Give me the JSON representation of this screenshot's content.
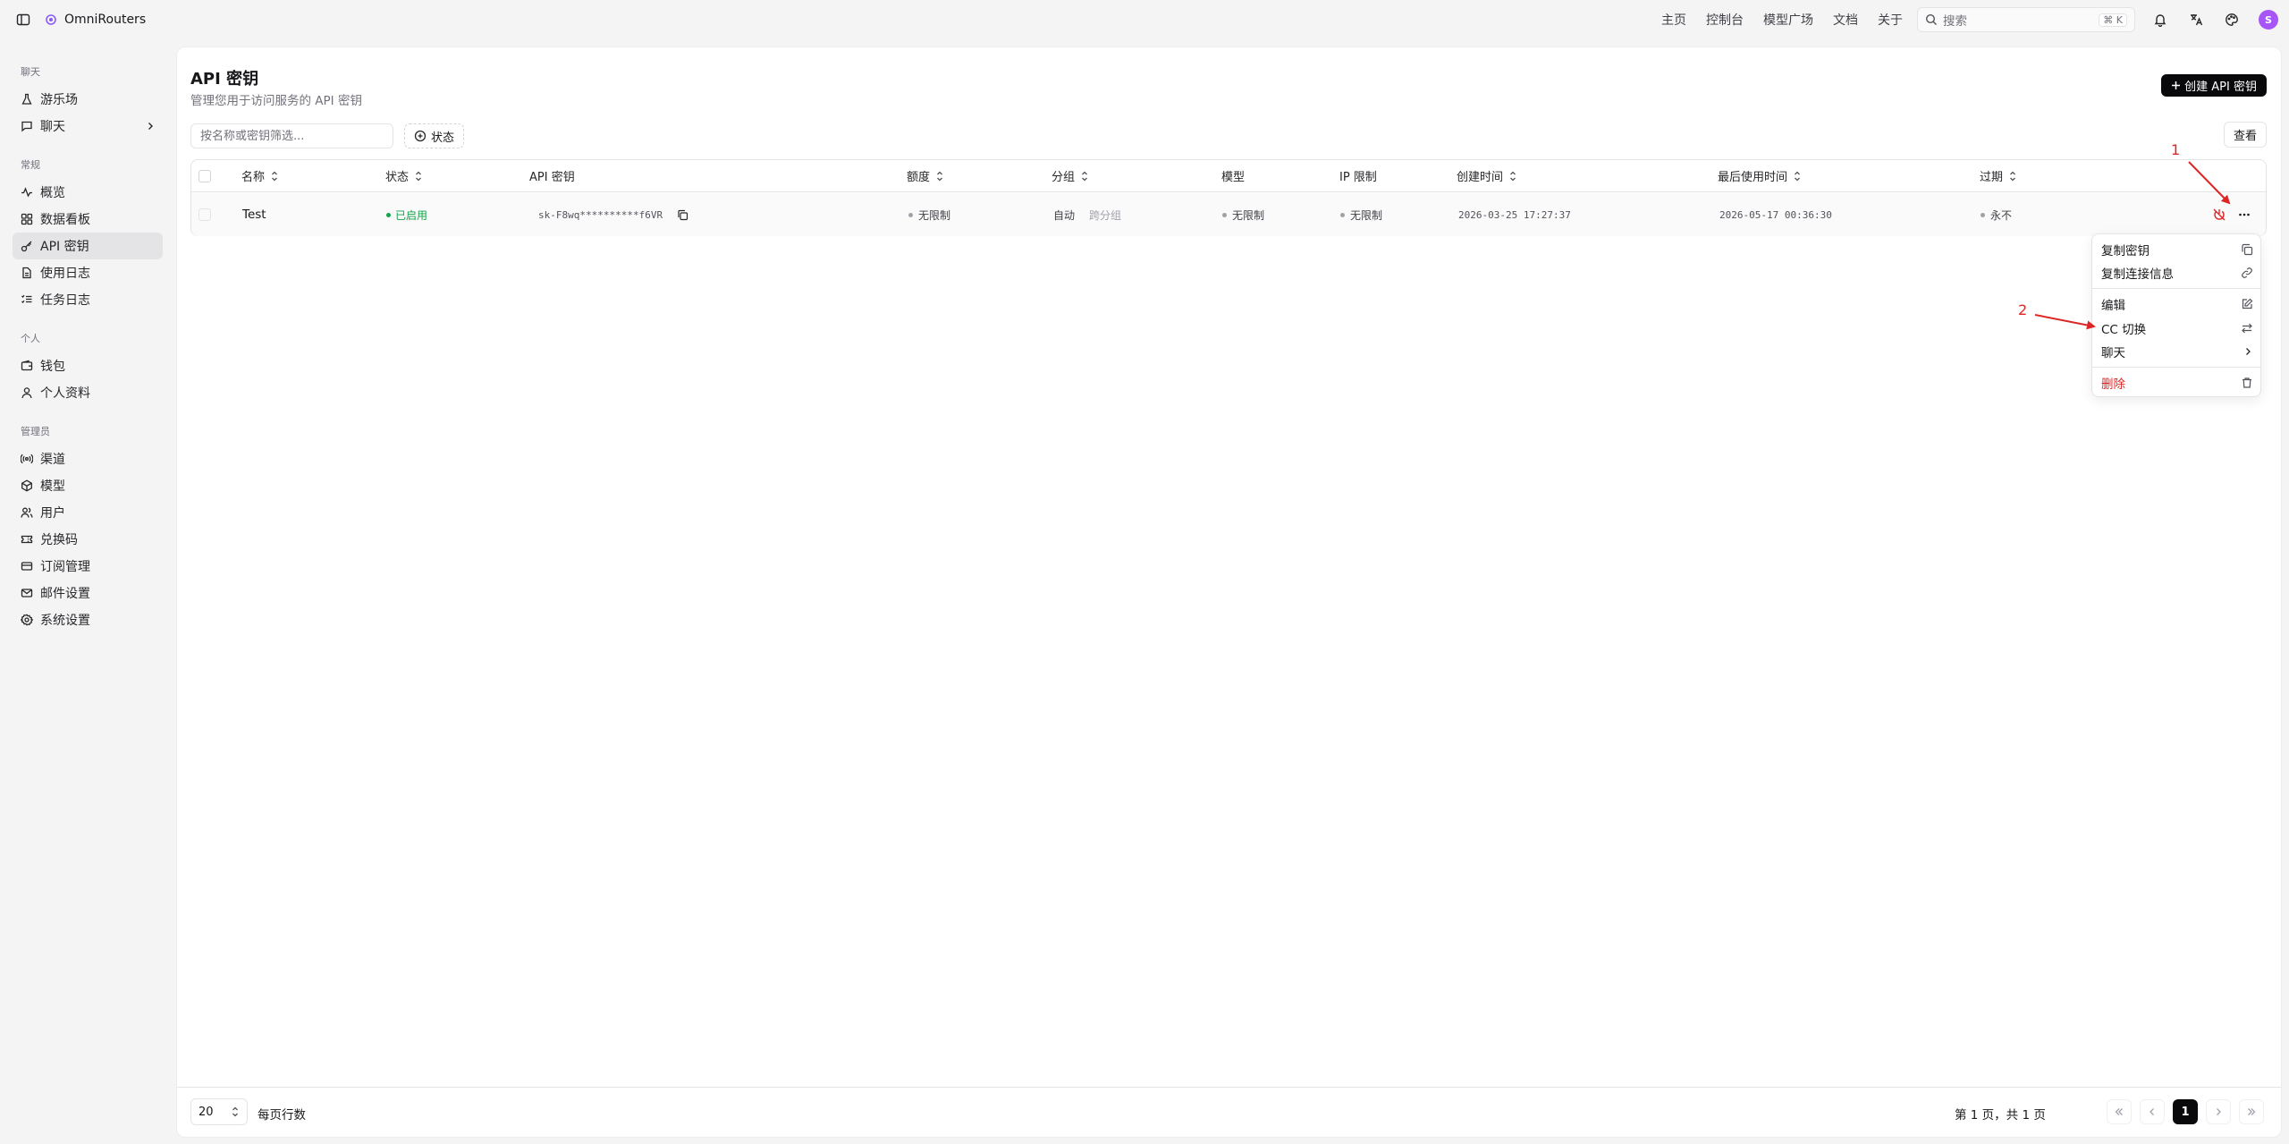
{
  "app": {
    "name": "OmniRouters",
    "avatar_letter": "S"
  },
  "topnav": {
    "links": [
      "主页",
      "控制台",
      "模型广场",
      "文档",
      "关于"
    ],
    "search_placeholder": "搜索",
    "search_shortcut": "⌘ K"
  },
  "sidebar": {
    "groups": [
      {
        "label": "聊天",
        "items": [
          {
            "label": "游乐场",
            "icon": "flask-icon"
          },
          {
            "label": "聊天",
            "icon": "chat-icon",
            "chevron": true
          }
        ]
      },
      {
        "label": "常规",
        "items": [
          {
            "label": "概览",
            "icon": "activity-icon"
          },
          {
            "label": "数据看板",
            "icon": "dashboard-icon"
          },
          {
            "label": "API 密钥",
            "icon": "key-icon",
            "active": true
          },
          {
            "label": "使用日志",
            "icon": "file-icon"
          },
          {
            "label": "任务日志",
            "icon": "list-check-icon"
          }
        ]
      },
      {
        "label": "个人",
        "items": [
          {
            "label": "钱包",
            "icon": "wallet-icon"
          },
          {
            "label": "个人资料",
            "icon": "user-icon"
          }
        ]
      },
      {
        "label": "管理员",
        "items": [
          {
            "label": "渠道",
            "icon": "radio-icon"
          },
          {
            "label": "模型",
            "icon": "box-icon"
          },
          {
            "label": "用户",
            "icon": "users-icon"
          },
          {
            "label": "兑换码",
            "icon": "ticket-icon"
          },
          {
            "label": "订阅管理",
            "icon": "card-icon"
          },
          {
            "label": "邮件设置",
            "icon": "mail-icon"
          },
          {
            "label": "系统设置",
            "icon": "settings-icon"
          }
        ]
      }
    ]
  },
  "page": {
    "title": "API 密钥",
    "subtitle": "管理您用于访问服务的 API 密钥",
    "create_label": "创建 API 密钥",
    "filter_placeholder": "按名称或密钥筛选...",
    "status_filter_label": "状态",
    "view_label": "查看"
  },
  "table": {
    "headers": {
      "name": "名称",
      "status": "状态",
      "key": "API 密钥",
      "quota": "额度",
      "group": "分组",
      "model": "模型",
      "ip": "IP 限制",
      "created": "创建时间",
      "last_used": "最后使用时间",
      "expire": "过期"
    },
    "rows": [
      {
        "name": "Test",
        "status": "已启用",
        "key": "sk-F8wq**********f6VR",
        "quota": "无限制",
        "group": "自动",
        "group_extra": "跨分组",
        "model": "无限制",
        "ip": "无限制",
        "created": "2026-03-25 17:27:37",
        "last_used": "2026-05-17 00:36:30",
        "expire": "永不"
      }
    ]
  },
  "menu": {
    "items": [
      {
        "label": "复制密钥",
        "icon": "copy-icon"
      },
      {
        "label": "复制连接信息",
        "icon": "link-icon"
      },
      {
        "label": "编辑",
        "icon": "edit-icon"
      },
      {
        "label": "CC 切换",
        "icon": "swap-icon"
      },
      {
        "label": "聊天",
        "icon": "chevron-right-icon"
      },
      {
        "label": "删除",
        "icon": "trash-icon",
        "danger": true
      }
    ]
  },
  "pagination": {
    "page_size": "20",
    "rows_label": "每页行数",
    "info": "第 1 页，共 1 页",
    "current": "1"
  },
  "annotations": {
    "one": "1",
    "two": "2"
  },
  "colors": {
    "accent": "#09090b",
    "success": "#16a34a",
    "danger": "#dc2626",
    "annotation": "#dc2626"
  }
}
